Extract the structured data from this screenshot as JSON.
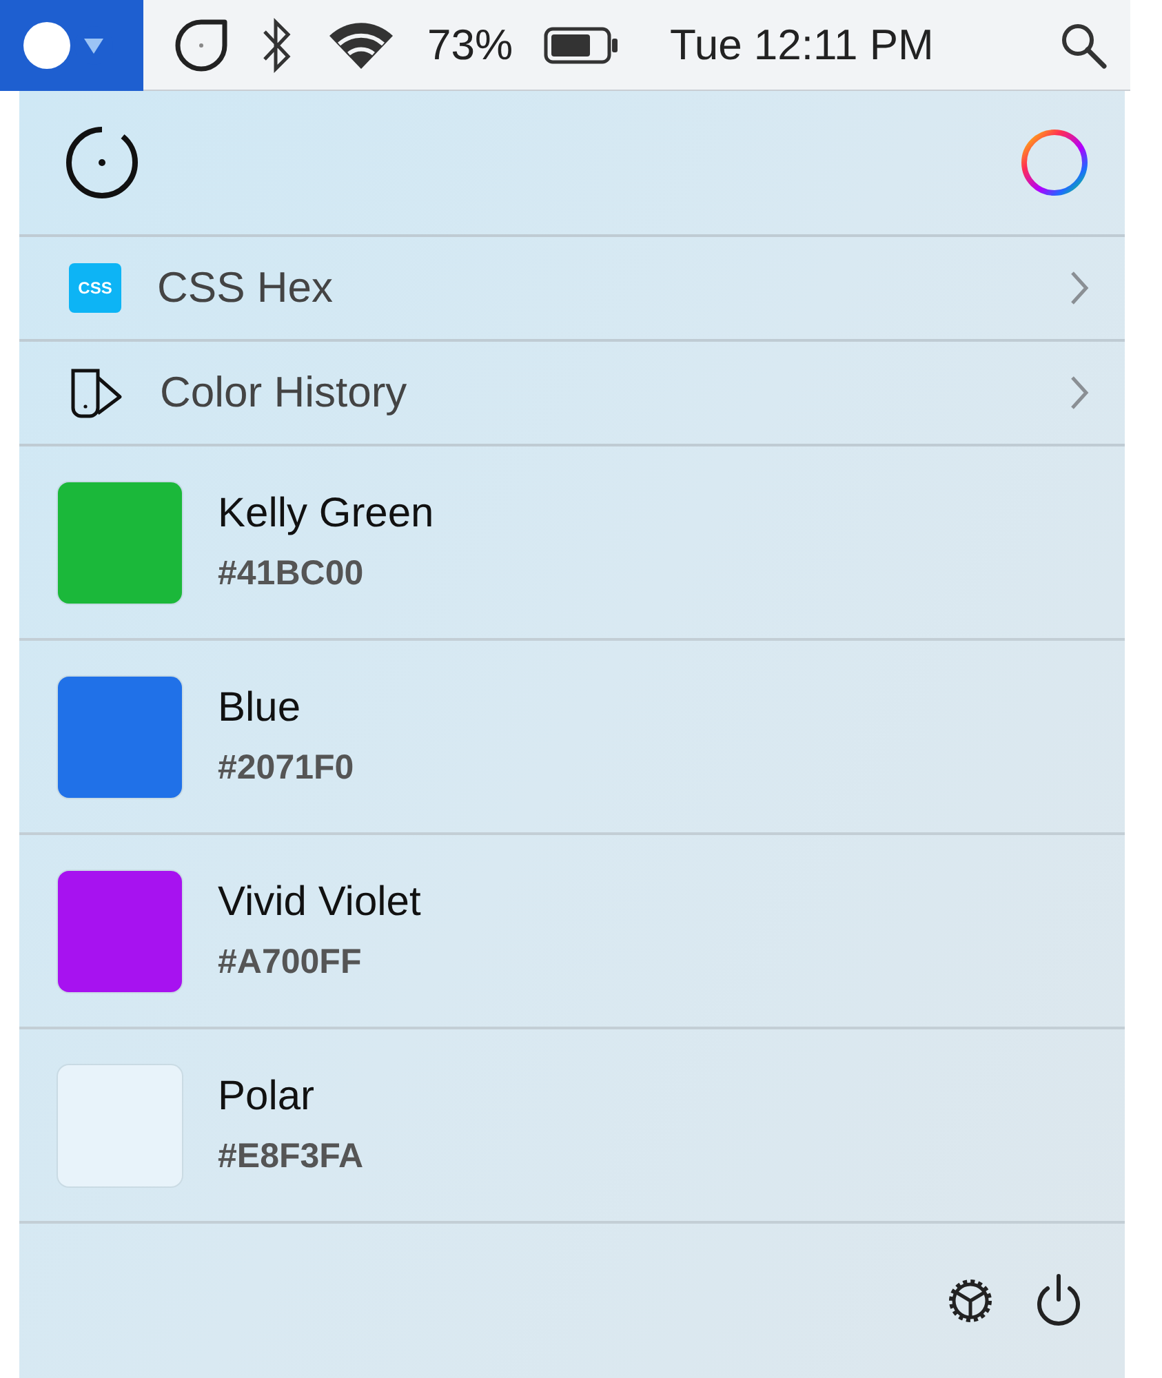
{
  "menu_bar": {
    "app_item": {
      "selected": true
    },
    "battery_percent": "73%",
    "clock": "Tue 12:11 PM"
  },
  "menu": [
    {
      "kind": "css",
      "badge": "CSS",
      "label": "CSS Hex"
    },
    {
      "kind": "history",
      "label": "Color History"
    }
  ],
  "colors": [
    {
      "name": "Kelly Green",
      "hex": "#41BC00",
      "color": "#1bb83a"
    },
    {
      "name": "Blue",
      "hex": "#2071F0",
      "color": "#2071e8"
    },
    {
      "name": "Vivid Violet",
      "hex": "#A700FF",
      "color": "#a712f0"
    },
    {
      "name": "Polar",
      "hex": "#E8F3FA",
      "color": "#e8f3fa"
    }
  ]
}
